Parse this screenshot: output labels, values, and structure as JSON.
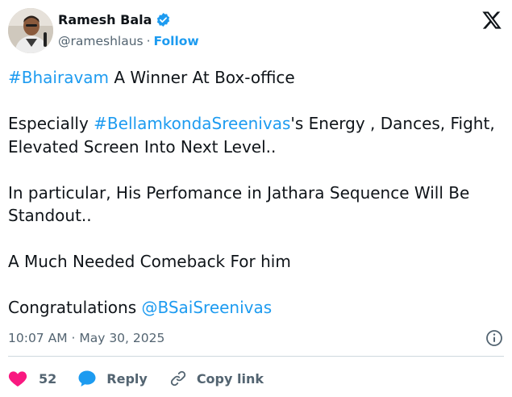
{
  "author": {
    "name": "Ramesh Bala",
    "handle": "@rameshlaus",
    "separator": "·",
    "follow_label": "Follow",
    "verified_color": "#1d9bf0"
  },
  "tweet": {
    "lines": [
      {
        "parts": [
          {
            "text": "#Bhairavam",
            "tag": true
          },
          {
            "text": " A Winner At Box-office",
            "tag": false
          }
        ]
      },
      {
        "parts": [
          {
            "text": "",
            "tag": false
          }
        ]
      },
      {
        "parts": [
          {
            "text": "Especially ",
            "tag": false
          },
          {
            "text": "#BellamkondaSreenivas",
            "tag": true
          },
          {
            "text": "'s Energy , Dances, Fight,",
            "tag": false
          }
        ]
      },
      {
        "parts": [
          {
            "text": "Elevated Screen Into Next Level..",
            "tag": false
          }
        ]
      },
      {
        "parts": [
          {
            "text": "",
            "tag": false
          }
        ]
      },
      {
        "parts": [
          {
            "text": "In particular, His Perfomance in Jathara Sequence Will Be",
            "tag": false
          }
        ]
      },
      {
        "parts": [
          {
            "text": "Standout..",
            "tag": false
          }
        ]
      },
      {
        "parts": [
          {
            "text": "",
            "tag": false
          }
        ]
      },
      {
        "parts": [
          {
            "text": "A Much Needed Comeback For him",
            "tag": false
          }
        ]
      },
      {
        "parts": [
          {
            "text": "",
            "tag": false
          }
        ]
      },
      {
        "parts": [
          {
            "text": "Congratulations ",
            "tag": false
          },
          {
            "text": "@BSaiSreenivas",
            "tag": true
          }
        ]
      }
    ]
  },
  "meta": {
    "timestamp": "10:07 AM · May 30, 2025",
    "info_icon": "info-icon"
  },
  "actions": {
    "like_count": "52",
    "reply_label": "Reply",
    "copy_label": "Copy link"
  },
  "colors": {
    "link": "#1d9bf0",
    "like": "#f91880",
    "muted": "#536471",
    "text": "#0f1419"
  }
}
